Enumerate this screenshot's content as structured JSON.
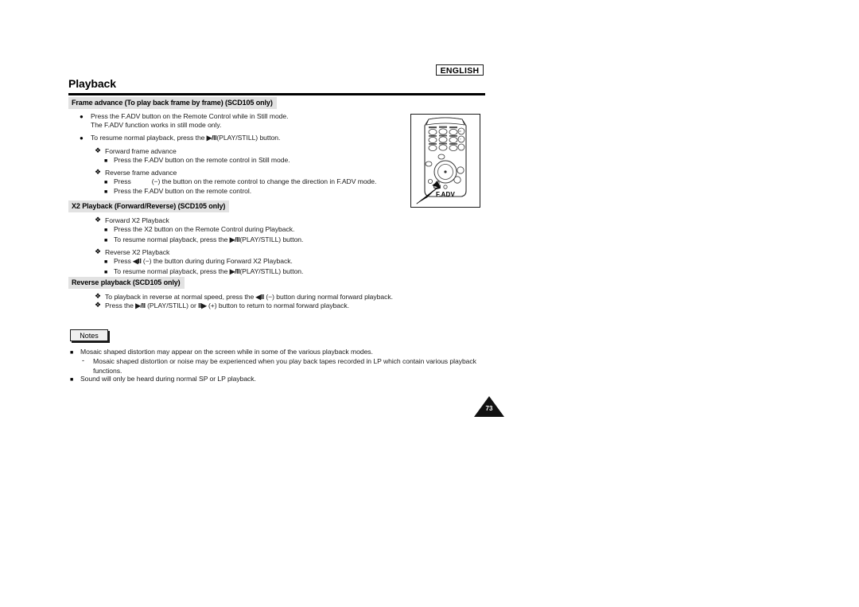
{
  "header": {
    "language_tag": "ENGLISH",
    "page_title": "Playback"
  },
  "sections": [
    {
      "heading": "Frame advance (To play back frame by frame) (SCD105 only)",
      "items": [
        {
          "marker": "circle",
          "text": "Press the F.ADV button on the Remote Control while in Still mode."
        },
        {
          "marker": "cont",
          "text": "The F.ADV function works in still mode only."
        },
        {
          "marker": "circle",
          "text": "To resume normal playback, press the ",
          "glyph": "▶/II",
          "text_after": "(PLAY/STILL) button."
        },
        {
          "marker": "clover",
          "text": "Forward frame advance"
        },
        {
          "marker": "square",
          "text": "Press the F.ADV button on the remote control in Still mode."
        },
        {
          "marker": "clover",
          "text": "Reverse frame advance"
        },
        {
          "marker": "square",
          "text": "Press",
          "gap": true,
          "text_after": "(−) the button on the remote control to change the direction in F.ADV mode."
        },
        {
          "marker": "square",
          "text": "Press the F.ADV button on the remote control."
        }
      ]
    },
    {
      "heading": "X2 Playback (Forward/Reverse) (SCD105 only)",
      "items": [
        {
          "marker": "clover",
          "text": "Forward X2 Playback"
        },
        {
          "marker": "square",
          "text": "Press the X2 button on the Remote Control during Playback."
        },
        {
          "marker": "square",
          "text": "To resume normal playback, press the ",
          "glyph": "▶/II",
          "text_after": "(PLAY/STILL) button."
        },
        {
          "marker": "clover",
          "text": "Reverse X2 Playback"
        },
        {
          "marker": "square",
          "text": "Press ",
          "glyph": "◀II",
          "text_after": " (−) the button during during Forward X2 Playback."
        },
        {
          "marker": "square",
          "text": "To resume normal playback, press the ",
          "glyph": "▶/II",
          "text_after": "(PLAY/STILL) button."
        }
      ]
    },
    {
      "heading": "Reverse playback (SCD105 only)",
      "items": [
        {
          "marker": "clover",
          "text": "To playback in reverse at normal speed, press the ",
          "glyph": "◀II",
          "text_after": " (−) button during normal forward playback."
        },
        {
          "marker": "clover",
          "text": "Press the ",
          "glyph": "▶/II",
          "text_mid": " (PLAY/STILL) or ",
          "glyph2": "II▶",
          "text_after": " (+) button to return to normal forward playback."
        }
      ]
    }
  ],
  "notes": {
    "label": "Notes",
    "items": [
      {
        "marker": "square",
        "text": "Mosaic shaped distortion may appear on the screen while in some of the various playback modes."
      },
      {
        "marker": "dash",
        "text": "Mosaic shaped distortion or noise may be experienced when you play back tapes recorded in LP which contain various playback functions."
      },
      {
        "marker": "square",
        "text": "Sound will only be heard during normal SP or LP playback."
      }
    ]
  },
  "figure": {
    "caption": "F.ADV",
    "description": "remote-control-illustration"
  },
  "footer": {
    "page_number": "73"
  }
}
